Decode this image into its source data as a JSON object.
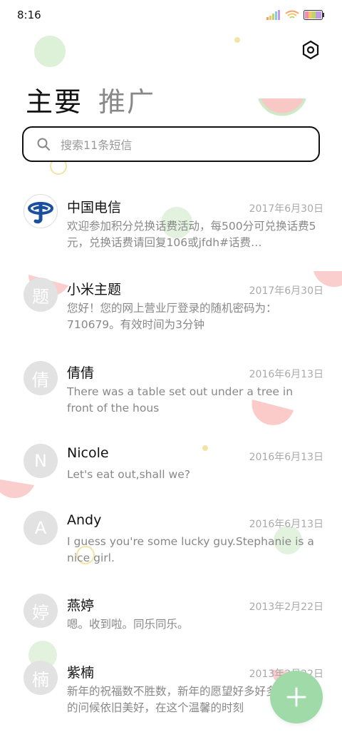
{
  "status_bar": {
    "time": "8:16"
  },
  "tabs": [
    {
      "label": "主要",
      "active": true
    },
    {
      "label": "推广",
      "active": false
    }
  ],
  "search": {
    "placeholder": "搜索11条短信"
  },
  "messages": [
    {
      "name": "中国电信",
      "avatar": "",
      "date": "2017年6月30日",
      "preview": "欢迎参加积分兑换话费活动，每500分可兑换话费5元，兑换话费请回复106或jfdh#话费…"
    },
    {
      "name": "小米主题",
      "avatar": "题",
      "date": "2017年6月30日",
      "preview": "您好！您的网上营业厅登录的随机密码为：710679。有效时间为3分钟"
    },
    {
      "name": "倩倩",
      "avatar": "倩",
      "date": "2016年6月13日",
      "preview": "There was a table set out under a tree in front of the hous"
    },
    {
      "name": "Nicole",
      "avatar": "N",
      "date": "2016年6月13日",
      "preview": "Let's eat out,shall we?"
    },
    {
      "name": "Andy",
      "avatar": "A",
      "date": "2016年6月13日",
      "preview": "I guess you're some lucky guy.Stephanie is a nice girl."
    },
    {
      "name": "燕婷",
      "avatar": "婷",
      "date": "2013年2月22日",
      "preview": "嗯。收到啦。同乐同乐。"
    },
    {
      "name": "紫楠",
      "avatar": "楠",
      "date": "2013年2月22日",
      "preview": "新年的祝福数不胜数，新年的愿望好多好多，新年的问候依旧美好，在这个温馨的时刻"
    }
  ],
  "icons": {
    "settings": "settings-hexagon-icon",
    "search": "search-icon",
    "compose": "plus-icon"
  },
  "colors": {
    "fab": "#9fdaa8",
    "watermelon": "#f7a8a8"
  }
}
